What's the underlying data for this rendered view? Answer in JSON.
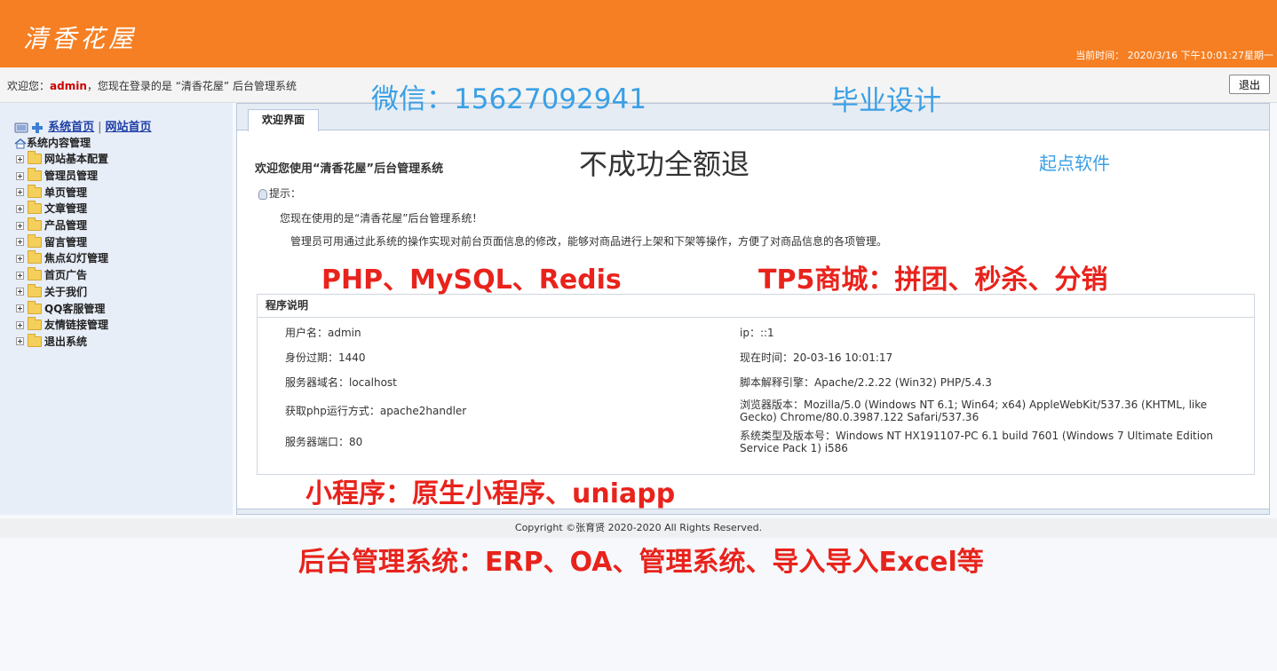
{
  "header": {
    "logo_text": "清香花屋",
    "current_time": "当前时间： 2020/3/16 下午10:01:27星期一",
    "bg_color": "#f57f22"
  },
  "userbar": {
    "welcome_prefix": "欢迎您：",
    "username": "admin",
    "welcome_suffix": "，您现在登录的是 “清香花屋” 后台管理系统",
    "logout_label": "退出"
  },
  "overlays": {
    "wechat": "微信：15627092941",
    "graduation": "毕业设计",
    "refund": "不成功全额退",
    "company": "起点软件",
    "stack": "PHP、MySQL、Redis",
    "tp5": "TP5商城：拼团、秒杀、分销",
    "miniprogram": "小程序：原生小程序、uniapp",
    "backend": "后台管理系统：ERP、OA、管理系统、导入导入Excel等"
  },
  "sidebar": {
    "system_home": "系统首页",
    "site_home": "网站首页",
    "separator": "|",
    "root_label": "系统内容管理",
    "items": [
      {
        "label": "网站基本配置"
      },
      {
        "label": "管理员管理"
      },
      {
        "label": "单页管理"
      },
      {
        "label": "文章管理"
      },
      {
        "label": "产品管理"
      },
      {
        "label": "留言管理"
      },
      {
        "label": "焦点幻灯管理"
      },
      {
        "label": "首页广告"
      },
      {
        "label": "关于我们"
      },
      {
        "label": "QQ客服管理"
      },
      {
        "label": "友情链接管理"
      },
      {
        "label": "退出系统"
      }
    ]
  },
  "main": {
    "tab_label": "欢迎界面",
    "intro_title": "欢迎您使用“清香花屋”后台管理系统",
    "tip_label": "提示：",
    "tip_line1": "您现在使用的是“清香花屋”后台管理系统！",
    "tip_line2": "管理员可用通过此系统的操作实现对前台页面信息的修改，能够对商品进行上架和下架等操作，方便了对商品信息的各项管理。",
    "info_title": "程序说明",
    "info_left": [
      "用户名：admin",
      "身份过期：1440",
      "服务器域名：localhost",
      "获取php运行方式：apache2handler",
      "服务器端口：80"
    ],
    "info_right": [
      "ip：::1",
      "现在时间：20-03-16 10:01:17",
      "脚本解释引擎：Apache/2.2.22 (Win32) PHP/5.4.3",
      "浏览器版本：Mozilla/5.0 (Windows NT 6.1; Win64; x64) AppleWebKit/537.36 (KHTML, like Gecko) Chrome/80.0.3987.122 Safari/537.36",
      "系统类型及版本号：Windows NT HX191107-PC 6.1 build 7601 (Windows 7 Ultimate Edition Service Pack 1) i586"
    ]
  },
  "footer": {
    "copyright": "Copyright ©张育贤 2020-2020 All Rights Reserved."
  }
}
